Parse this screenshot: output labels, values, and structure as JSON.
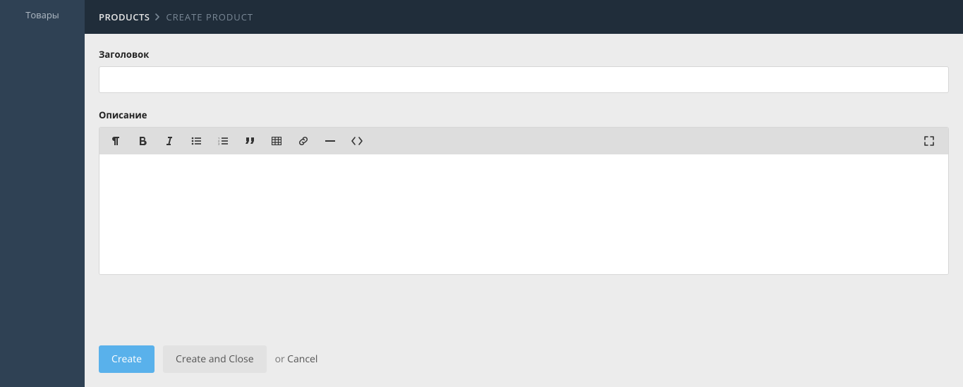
{
  "sidebar": {
    "items": [
      {
        "label": "Товары"
      }
    ]
  },
  "breadcrumb": {
    "primary": "PRODUCTS",
    "secondary": "CREATE PRODUCT"
  },
  "form": {
    "title_label": "Заголовок",
    "title_value": "",
    "desc_label": "Описание",
    "desc_value": ""
  },
  "actions": {
    "create": "Create",
    "create_close": "Create and Close",
    "or": "or",
    "cancel": "Cancel"
  }
}
